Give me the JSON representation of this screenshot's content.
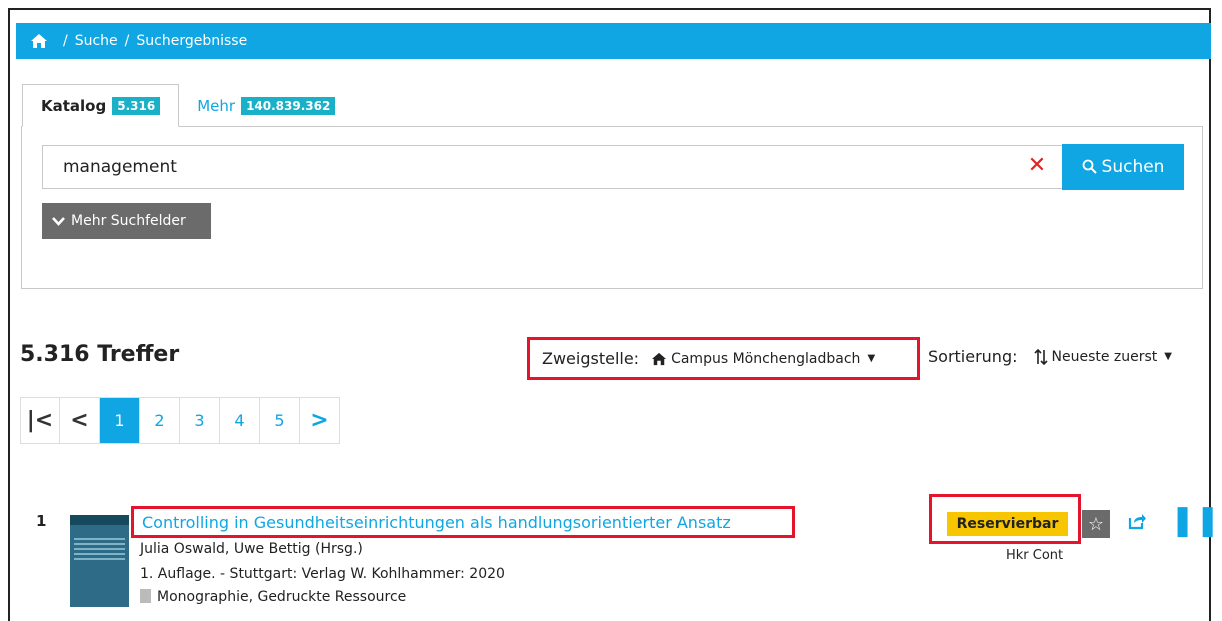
{
  "breadcrumb": {
    "items": [
      "Suche",
      "Suchergebnisse"
    ],
    "separator": "/"
  },
  "tabs": [
    {
      "label": "Katalog",
      "count": "5.316"
    },
    {
      "label": "Mehr",
      "count": "140.839.362"
    }
  ],
  "search": {
    "value": "management",
    "clear": "✕",
    "button_label": "Suchen"
  },
  "more_fields_label": "Mehr Suchfelder",
  "results": {
    "hits_label": "5.316 Treffer",
    "branch": {
      "label": "Zweigstelle:",
      "value": "Campus Mönchengladbach"
    },
    "sort": {
      "label": "Sortierung:",
      "value": "Neueste zuerst"
    }
  },
  "pagination": {
    "first": "|<",
    "prev": "<",
    "pages": [
      "1",
      "2",
      "3",
      "4",
      "5"
    ],
    "next": ">"
  },
  "result_item": {
    "number": "1",
    "title": "Controlling in Gesundheitseinrichtungen als handlungsorientierter Ansatz",
    "authors": "Julia Oswald, Uwe Bettig (Hrsg.)",
    "edition": "1. Auflage. - Stuttgart: Verlag W. Kohlhammer: 2020",
    "type": "Monographie, Gedruckte Ressource",
    "availability": "Reservierbar",
    "shelfmark": "Hkr Cont"
  },
  "colors": {
    "accent": "#0fa6e3",
    "highlight": "#e3142c",
    "availability": "#f7c600"
  }
}
